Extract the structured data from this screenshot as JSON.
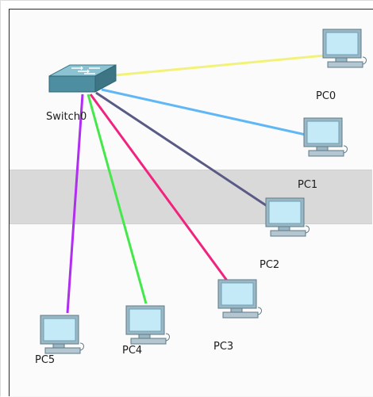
{
  "topology": {
    "switch": {
      "name": "Switch0",
      "icon": "switch-icon"
    },
    "pcs": [
      {
        "id": "pc0",
        "name": "PC0",
        "icon": "pc-icon",
        "link_color": "#f2f27a"
      },
      {
        "id": "pc1",
        "name": "PC1",
        "icon": "pc-icon",
        "link_color": "#5fb7f5"
      },
      {
        "id": "pc2",
        "name": "PC2",
        "icon": "pc-icon",
        "link_color": "#5a5a86"
      },
      {
        "id": "pc3",
        "name": "PC3",
        "icon": "pc-icon",
        "link_color": "#f0237e"
      },
      {
        "id": "pc4",
        "name": "PC4",
        "icon": "pc-icon",
        "link_color": "#45e84a"
      },
      {
        "id": "pc5",
        "name": "PC5",
        "icon": "pc-icon",
        "link_color": "#b02ef0"
      }
    ]
  },
  "colors": {
    "background": "#fbfbfb",
    "band": "#d9d9d9",
    "pc_screen": "#bfe6f5",
    "switch_body": "#5c9fb0"
  }
}
